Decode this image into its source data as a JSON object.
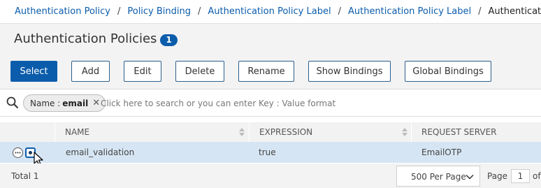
{
  "breadcrumb": {
    "items": [
      "Authentication Policy",
      "Policy Binding",
      "Authentication Policy Label",
      "Authentication Policy Label"
    ],
    "separator": "/",
    "current": "Authentication Policies"
  },
  "header": {
    "title": "Authentication Policies",
    "count": "1"
  },
  "toolbar": {
    "select": "Select",
    "add": "Add",
    "edit": "Edit",
    "delete": "Delete",
    "rename": "Rename",
    "show_bindings": "Show Bindings",
    "global_bindings": "Global Bindings"
  },
  "search": {
    "chip_key": "Name :",
    "chip_value": "email",
    "chip_close": "✕",
    "placeholder": "Click here to search or you can enter Key : Value format"
  },
  "table": {
    "columns": [
      "NAME",
      "EXPRESSION",
      "REQUEST SERVER"
    ],
    "rows": [
      {
        "name": "email_validation",
        "expression": "true",
        "request_server": "EmailOTP",
        "selected": true
      }
    ]
  },
  "footer": {
    "total": "Total 1",
    "per_page": "500 Per Page",
    "page_label": "Page",
    "page_value": "1",
    "of": "of"
  },
  "colors": {
    "accent": "#0b5cab",
    "selected_row": "#d6e5f3",
    "header_bg": "#f3f3f3"
  },
  "icons": [
    "search-icon",
    "close-icon",
    "sort-icon",
    "more-icon",
    "radio-icon",
    "chevron-down-icon",
    "cursor-icon"
  ]
}
